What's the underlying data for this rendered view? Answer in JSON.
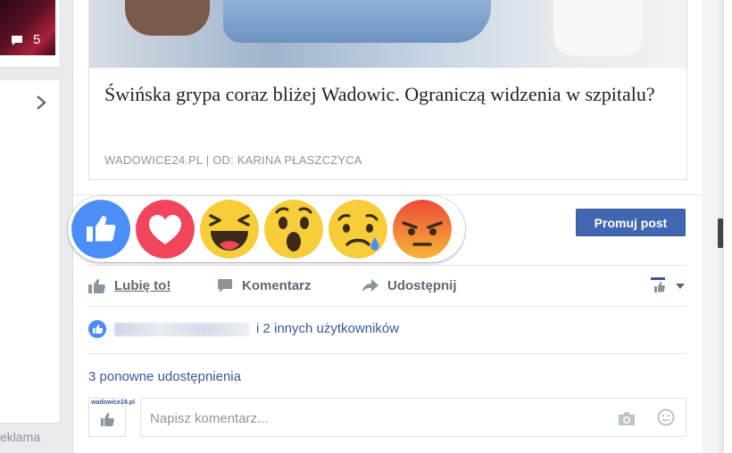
{
  "left": {
    "thumbnail": {
      "comment_count": "5"
    },
    "ad_label": "eklama"
  },
  "post": {
    "link": {
      "title": "Świńska grypa coraz bliżej Wadowic. Ograniczą widzenia w szpitalu?",
      "source": "WADOWICE24.PL | OD: KARINA PŁASZCZYCA"
    },
    "promote_button": "Promuj post",
    "actions": {
      "like": "Lubię to!",
      "comment": "Komentarz",
      "share": "Udostępnij"
    },
    "likes_summary": "i 2 innych użytkowników",
    "shares_summary": "3 ponowne udostępnienia",
    "comment_box": {
      "placeholder": "Napisz komentarz...",
      "avatar_brand": "wadowice24.pl"
    }
  },
  "reactions": [
    {
      "name": "like",
      "icon": "thumbs-up-icon",
      "color": "#4c8ef7"
    },
    {
      "name": "love",
      "icon": "heart-icon",
      "color": "#f0455a"
    },
    {
      "name": "haha",
      "icon": "laughing-face-icon",
      "color": "#f7cd3a"
    },
    {
      "name": "wow",
      "icon": "surprised-face-icon",
      "color": "#f7cd3a"
    },
    {
      "name": "sad",
      "icon": "crying-face-icon",
      "color": "#f7cd3a"
    },
    {
      "name": "angry",
      "icon": "angry-face-icon",
      "color": "#f25c3a"
    }
  ],
  "colors": {
    "brand_blue": "#4267b2",
    "link_blue": "#385898",
    "muted_gray": "#90949c"
  }
}
